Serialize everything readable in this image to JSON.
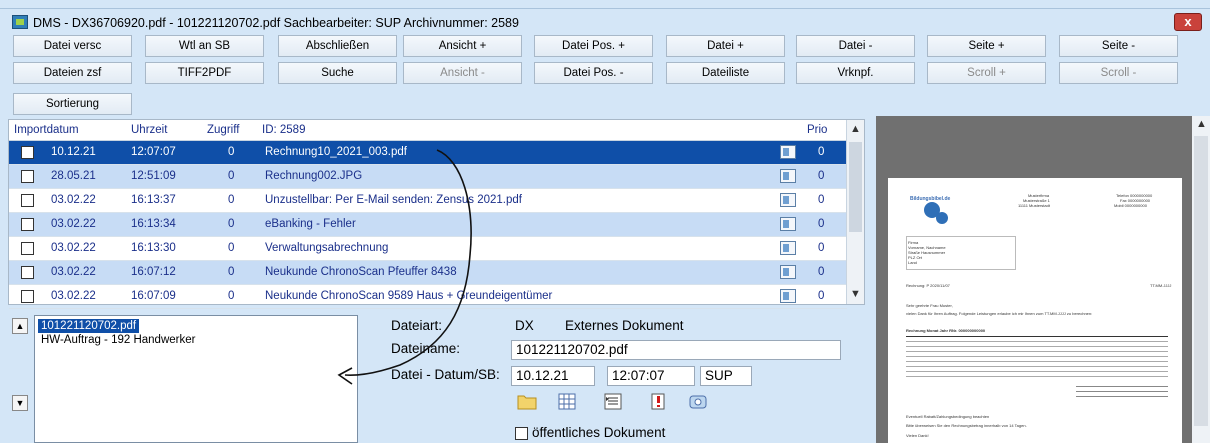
{
  "window": {
    "title": "DMS - DX36706920.pdf - 101221120702.pdf Sachbearbeiter: SUP Archivnummer: 2589",
    "close_label": "x"
  },
  "toolbar": {
    "row1": [
      {
        "label": "Datei versc",
        "enabled": true
      },
      {
        "label": "Wtl an SB",
        "enabled": true
      },
      {
        "label": "Abschließen",
        "enabled": true
      },
      {
        "label": "Ansicht +",
        "enabled": true
      },
      {
        "label": "Datei Pos. +",
        "enabled": true
      },
      {
        "label": "Datei +",
        "enabled": true
      },
      {
        "label": "Datei -",
        "enabled": true
      },
      {
        "label": "Seite +",
        "enabled": true
      },
      {
        "label": "Seite -",
        "enabled": true
      }
    ],
    "row2": [
      {
        "label": "Dateien zsf",
        "enabled": true
      },
      {
        "label": "TIFF2PDF",
        "enabled": true
      },
      {
        "label": "Suche",
        "enabled": true
      },
      {
        "label": "Ansicht -",
        "enabled": false
      },
      {
        "label": "Datei Pos. -",
        "enabled": true
      },
      {
        "label": "Dateiliste",
        "enabled": true
      },
      {
        "label": "Vrknpf.",
        "enabled": true
      },
      {
        "label": "Scroll +",
        "enabled": false
      },
      {
        "label": "Scroll -",
        "enabled": false
      }
    ],
    "row3": [
      {
        "label": "Sortierung",
        "enabled": true
      }
    ]
  },
  "list": {
    "headers": {
      "importdatum": "Importdatum",
      "uhrzeit": "Uhrzeit",
      "zugriff": "Zugriff",
      "id": "ID: 2589",
      "prio": "Prio"
    },
    "rows": [
      {
        "date": "10.12.21",
        "time": "12:07:07",
        "access": "0",
        "name": "Rechnung10_2021_003.pdf",
        "prio": "0",
        "selected": true
      },
      {
        "date": "28.05.21",
        "time": "12:51:09",
        "access": "0",
        "name": "Rechnung002.JPG",
        "prio": "0",
        "selected": false
      },
      {
        "date": "03.02.22",
        "time": "16:13:37",
        "access": "0",
        "name": "Unzustellbar: Per E-Mail senden: Zensus 2021.pdf",
        "prio": "0",
        "selected": false
      },
      {
        "date": "03.02.22",
        "time": "16:13:34",
        "access": "0",
        "name": "eBanking - Fehler",
        "prio": "0",
        "selected": false
      },
      {
        "date": "03.02.22",
        "time": "16:13:30",
        "access": "0",
        "name": "Verwaltungsabrechnung",
        "prio": "0",
        "selected": false
      },
      {
        "date": "03.02.22",
        "time": "16:07:12",
        "access": "0",
        "name": "Neukunde ChronoScan Pfeuffer  8438",
        "prio": "0",
        "selected": false
      },
      {
        "date": "03.02.22",
        "time": "16:07:09",
        "access": "0",
        "name": "Neukunde ChronoScan  9589  Haus + Greundeigentümer",
        "prio": "0",
        "selected": false
      }
    ]
  },
  "filelist": {
    "selected": "101221120702.pdf",
    "items": [
      "HW-Auftrag -  192 Handwerker"
    ]
  },
  "details": {
    "dateiart_label": "Dateiart:",
    "dateiart_code": "DX",
    "dateiart_text": "Externes Dokument",
    "dateiname_label": "Dateiname:",
    "dateiname_value": "101221120702.pdf",
    "datum_label": "Datei - Datum/SB:",
    "datum_value": "10.12.21",
    "zeit_value": "12:07:07",
    "sb_value": "SUP",
    "public_label": "öffentliches Dokument",
    "public_checked": false
  },
  "tool_icons": [
    "folder-icon",
    "grid-icon",
    "list-icon",
    "alert-icon",
    "scan-icon"
  ],
  "preview": {
    "logo_text": "Bildungsbibel.de",
    "company": "Musterfirma",
    "address1": "Musterstraße 1",
    "address2": "11111 Musterstadt",
    "phone": "Telefon 0000000000",
    "fax": "Fax 0000000000",
    "mobile": "Mobil 0000000000",
    "recipient_lines": [
      "Firma",
      "Vorname, Nachname",
      "Straße Hausnummer",
      "PLZ Ort",
      "Land"
    ],
    "date": "TT.MM.JJJJ",
    "rechnung": "Rechnung: P 2020/11/07",
    "greeting": "Sehr geehrte Frau Muster,",
    "intro": "vielen Dank für Ihren Auftrag. Folgende Leistungen erlaube ich mir Ihnen zum TT.MM.JJJJ zu berechnen:",
    "section": "Rechnung Monat Jahr   RNr. 000000000000",
    "closing1": "Eventuell Rabatt/Zahlungsbedingung beachten",
    "closing2": "Bitte überweisen Sie den Rechnungsbetrag innerhalb von 14 Tagen.",
    "closing3": "Vielen Dank!"
  },
  "colors": {
    "window_bg": "#d4e6f7",
    "selected_row": "#0f4fa8",
    "alt_row": "#c7dcf5",
    "list_text": "#1a2f8a",
    "close_button": "#c9423b"
  }
}
